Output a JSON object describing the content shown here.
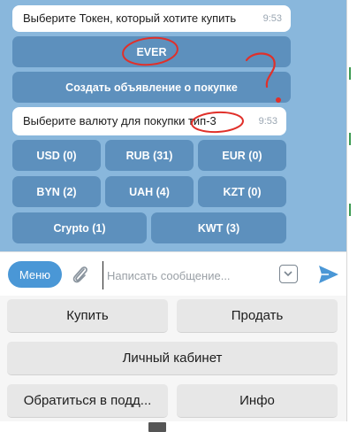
{
  "messages": [
    {
      "text": "Выберите Токен, который хотите купить",
      "time": "9:53"
    },
    {
      "text": "Выберите валюту для покупки тип-3",
      "time": "9:53"
    }
  ],
  "token_buttons": {
    "ever": "EVER",
    "create_ad": "Создать объявление о покупке"
  },
  "currency_buttons": [
    "USD (0)",
    "RUB (31)",
    "EUR (0)",
    "BYN (2)",
    "UAH (4)",
    "KZT (0)",
    "Crypto (1)",
    "KWT (3)"
  ],
  "composer": {
    "menu_label": "Меню",
    "placeholder": "Написать сообщение..."
  },
  "keyboard": {
    "buy": "Купить",
    "sell": "Продать",
    "cabinet": "Личный кабинет",
    "support": "Обратиться в подд...",
    "info": "Инфо"
  },
  "colors": {
    "chat_bg": "#89b7dc",
    "inline_button": "#5d90bd",
    "menu_button": "#4a97d6",
    "annotation": "#e0302a"
  },
  "icons": [
    "paperclip-icon",
    "emoji-icon",
    "send-icon",
    "keyboard-icon"
  ]
}
